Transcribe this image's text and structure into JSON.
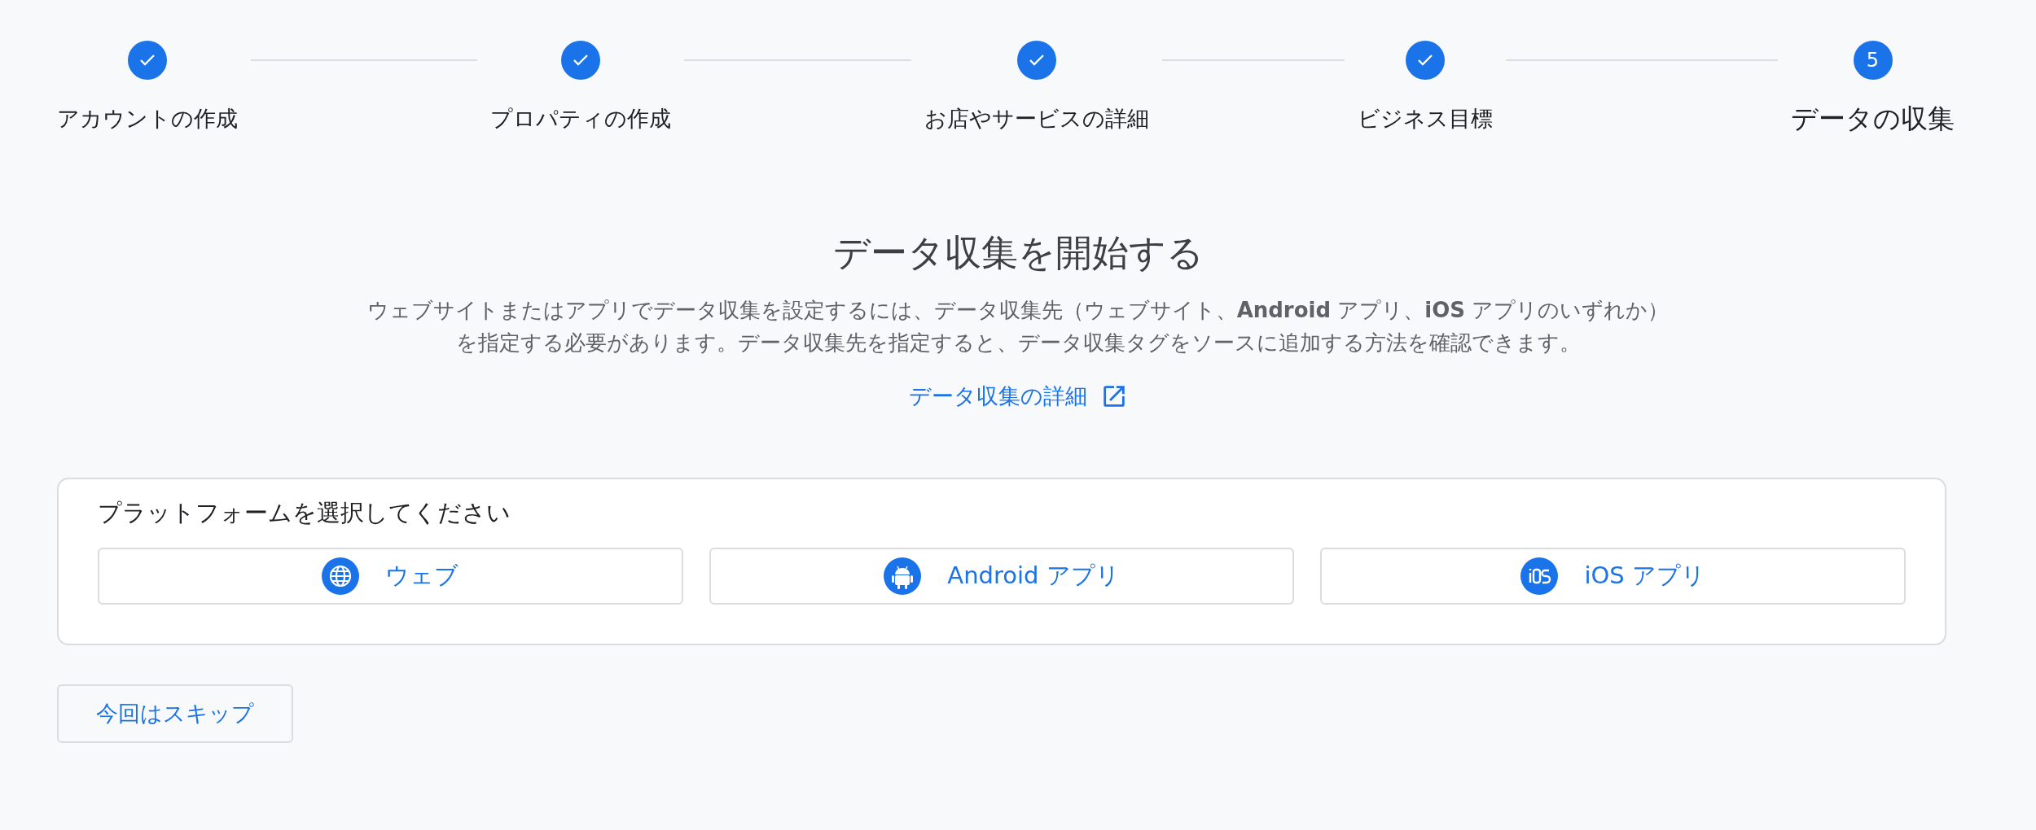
{
  "steps": [
    {
      "label": "アカウントの作成",
      "done": true
    },
    {
      "label": "プロパティの作成",
      "done": true
    },
    {
      "label": "お店やサービスの詳細",
      "done": true
    },
    {
      "label": "ビジネス目標",
      "done": true
    },
    {
      "label": "データの収集",
      "done": false,
      "number": "5"
    }
  ],
  "heading": "データ収集を開始する",
  "description": "ウェブサイトまたはアプリでデータ収集を設定するには、データ収集先（ウェブサイト、**Android** アプリ、**iOS** アプリのいずれか）を指定する必要があります。データ収集先を指定すると、データ収集タグをソースに追加する方法を確認できます。",
  "link": "データ収集の詳細",
  "platform_card": {
    "title": "プラットフォームを選択してください",
    "options": [
      {
        "kind": "web",
        "label": "ウェブ"
      },
      {
        "kind": "android",
        "label": "Android アプリ"
      },
      {
        "kind": "ios",
        "label": "iOS アプリ"
      }
    ]
  },
  "skip_button": "今回はスキップ"
}
